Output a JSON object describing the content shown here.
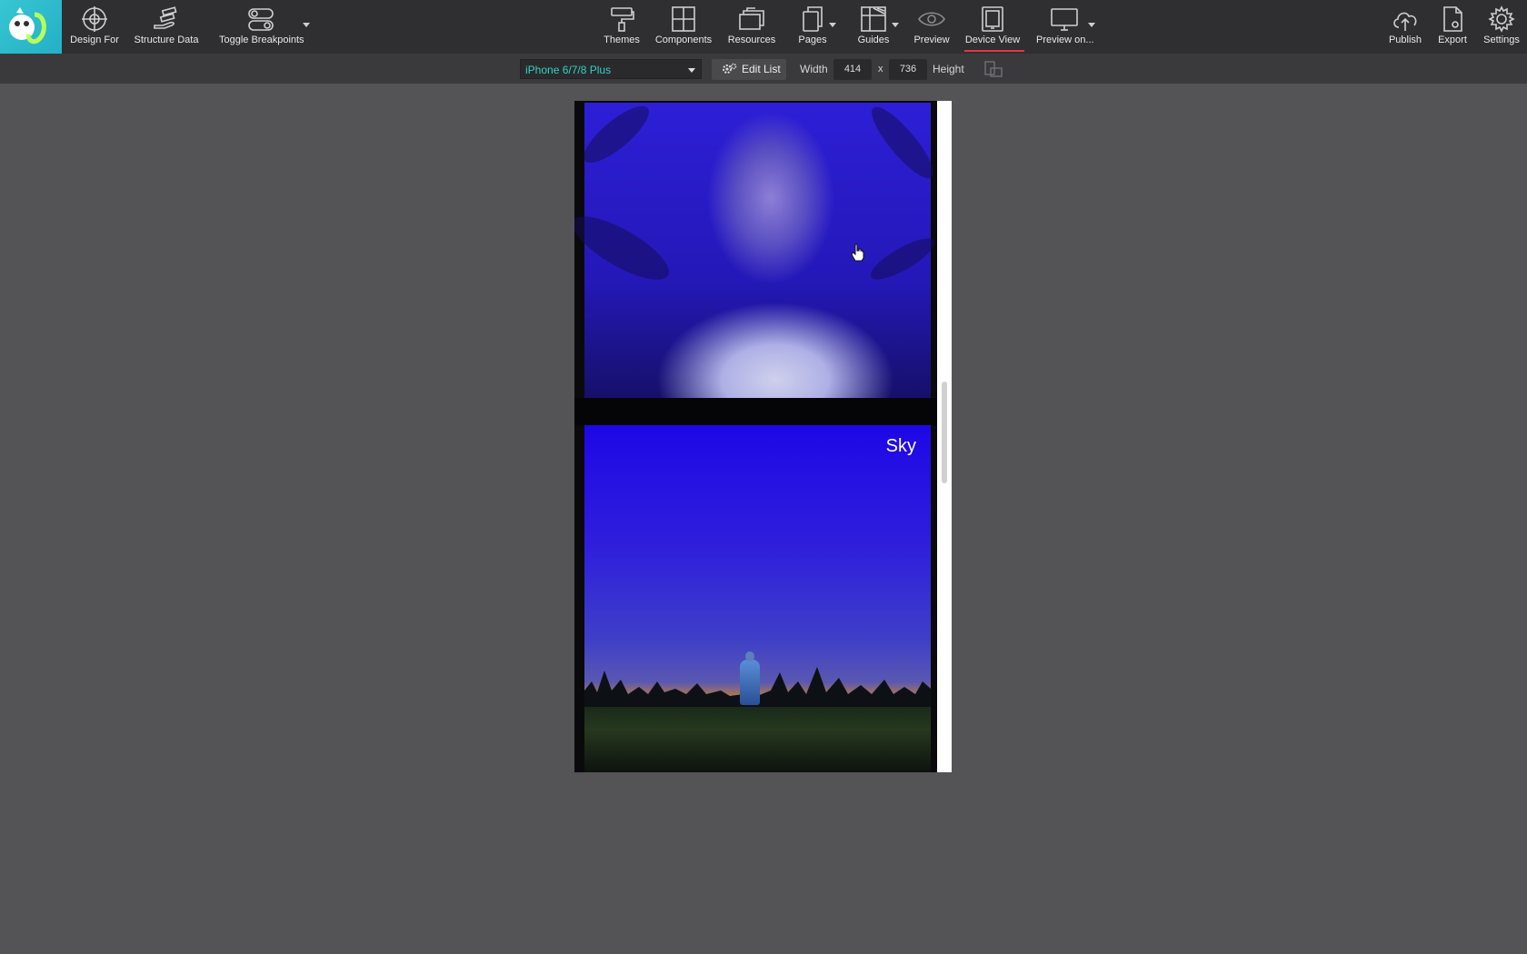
{
  "toolbar": {
    "left": [
      {
        "label": "Design For",
        "icon": "crosshair-icon"
      },
      {
        "label": "Structure Data",
        "icon": "hand-data-icon"
      },
      {
        "label": "Toggle Breakpoints",
        "icon": "breakpoints-icon"
      }
    ],
    "center": [
      {
        "label": "Themes",
        "icon": "paint-roller-icon"
      },
      {
        "label": "Components",
        "icon": "components-icon"
      },
      {
        "label": "Resources",
        "icon": "folders-icon"
      },
      {
        "label": "Pages",
        "icon": "pages-icon"
      },
      {
        "label": "Guides",
        "icon": "guides-icon"
      },
      {
        "label": "Preview",
        "icon": "eye-icon"
      },
      {
        "label": "Device View",
        "icon": "device-view-icon"
      },
      {
        "label": "Preview on...",
        "icon": "monitor-icon"
      }
    ],
    "right": [
      {
        "label": "Publish",
        "icon": "cloud-upload-icon"
      },
      {
        "label": "Export",
        "icon": "export-icon"
      },
      {
        "label": "Settings",
        "icon": "gear-icon"
      }
    ],
    "active_item": "Device View",
    "accent_color": "#e0364b"
  },
  "subbar": {
    "device": "iPhone 6/7/8 Plus",
    "edit_list_label": "Edit List",
    "width_label": "Width",
    "width_value": "414",
    "separator": "x",
    "height_value": "736",
    "height_label": "Height"
  },
  "canvas": {
    "cards": [
      {
        "label": ""
      },
      {
        "label": "Sky"
      }
    ]
  },
  "colors": {
    "brand": "#2bb8c9",
    "device_text": "#34d0c8",
    "background": "#545456",
    "toolbar": "#2f2f31"
  }
}
